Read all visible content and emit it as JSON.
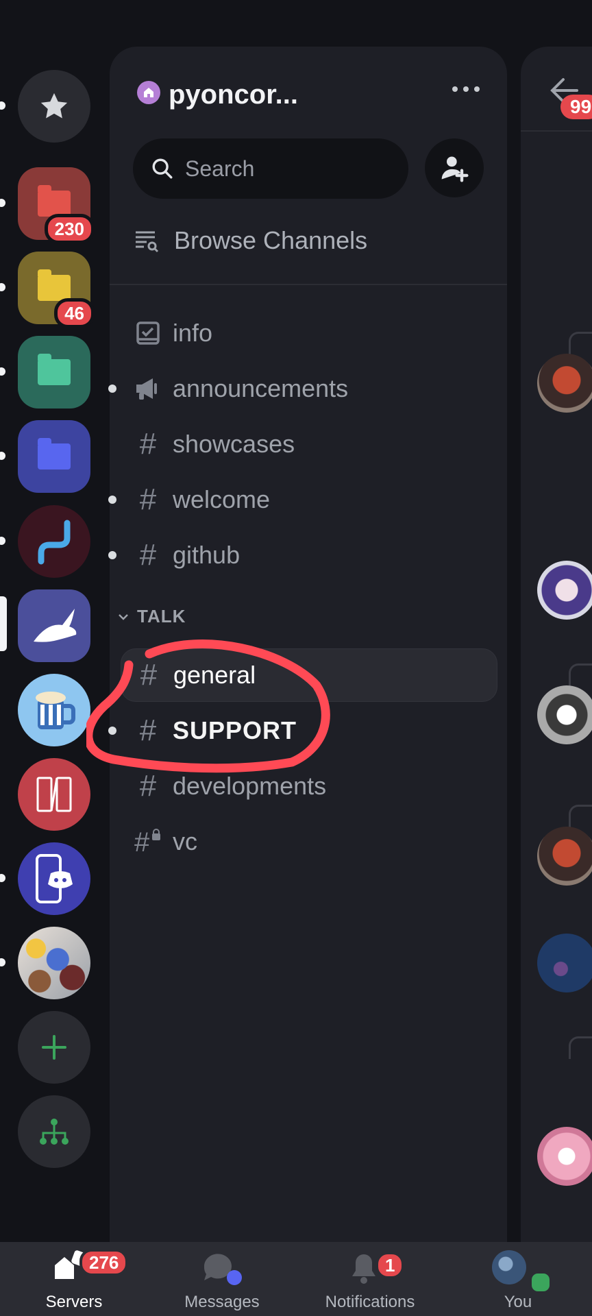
{
  "server": {
    "name": "pyoncor...",
    "search_placeholder": "Search",
    "browse_label": "Browse Channels"
  },
  "channels": [
    {
      "name": "info",
      "icon": "rules-icon",
      "unread": false
    },
    {
      "name": "announcements",
      "icon": "megaphone-icon",
      "unread": true
    },
    {
      "name": "showcases",
      "icon": "hash-icon",
      "unread": false
    },
    {
      "name": "welcome",
      "icon": "hash-icon",
      "unread": true
    },
    {
      "name": "github",
      "icon": "hash-icon",
      "unread": true
    }
  ],
  "category": {
    "name": "TALK"
  },
  "talk_channels": [
    {
      "name": "general",
      "icon": "hash-icon",
      "selected": true
    },
    {
      "name": "SUPPORT",
      "icon": "hash-icon",
      "unread": true
    },
    {
      "name": "developments",
      "icon": "hash-icon"
    },
    {
      "name": "vc",
      "icon": "locked-hash-icon"
    }
  ],
  "rail": {
    "badges": [
      "230",
      "46"
    ]
  },
  "chat_peek": {
    "badge": "99"
  },
  "nav": {
    "servers": {
      "label": "Servers",
      "badge": "276"
    },
    "messages": {
      "label": "Messages"
    },
    "notifications": {
      "label": "Notifications",
      "badge": "1"
    },
    "you": {
      "label": "You"
    }
  },
  "colors": {
    "accent_red": "#e5484d",
    "annotation_red": "#ff4a55",
    "online_green": "#3ba55c"
  }
}
